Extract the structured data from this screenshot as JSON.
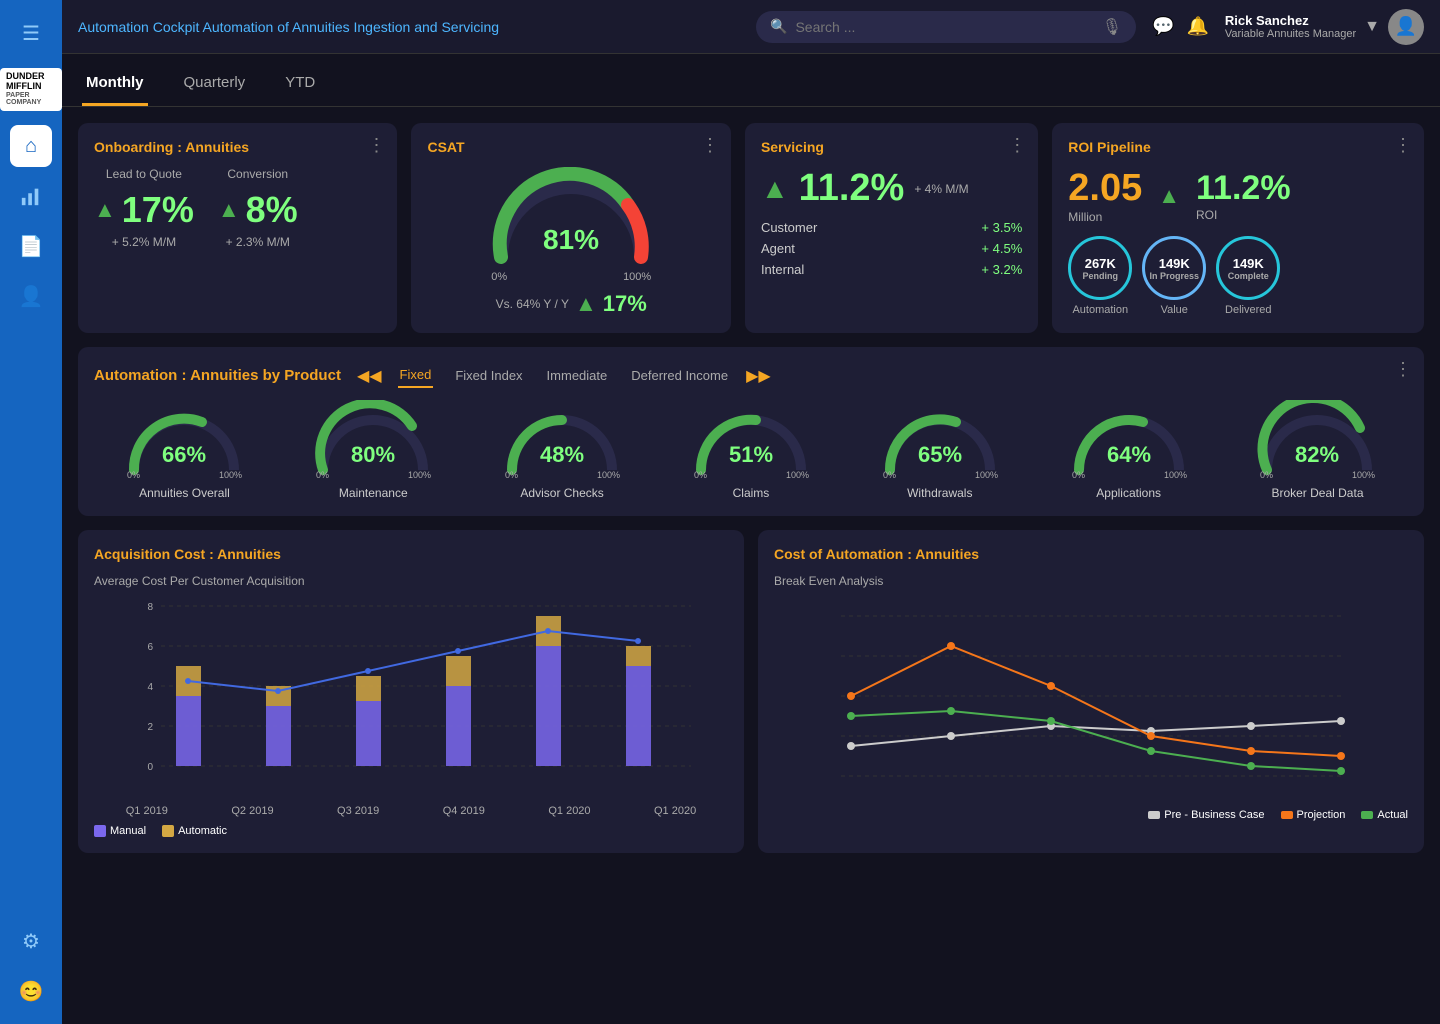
{
  "topbar": {
    "title": "Automation Cockpit Automation of Annuities Ingestion and Servicing",
    "search_placeholder": "Search ...",
    "user_name": "Rick Sanchez",
    "user_role": "Variable Annuites Manager"
  },
  "tabs": [
    {
      "label": "Monthly",
      "active": true
    },
    {
      "label": "Quarterly",
      "active": false
    },
    {
      "label": "YTD",
      "active": false
    }
  ],
  "onboarding": {
    "title": "Onboarding : Annuities",
    "lead_label": "Lead to Quote",
    "conversion_label": "Conversion",
    "lead_value": "17%",
    "conversion_value": "8%",
    "lead_sub": "+ 5.2% M/M",
    "conversion_sub": "+ 2.3% M/M"
  },
  "csat": {
    "title": "CSAT",
    "value": 81,
    "vs_label": "Vs.  64% Y / Y",
    "vs_value": "17%"
  },
  "servicing": {
    "title": "Servicing",
    "main_value": "11.2%",
    "main_delta": "+ 4% M/M",
    "rows": [
      {
        "label": "Customer",
        "value": "+ 3.5%"
      },
      {
        "label": "Agent",
        "value": "+ 4.5%"
      },
      {
        "label": "Internal",
        "value": "+ 3.2%"
      }
    ]
  },
  "roi": {
    "title": "ROI Pipeline",
    "million_value": "2.05",
    "million_label": "Million",
    "roi_pct": "11.2%",
    "roi_label": "ROI",
    "circles": [
      {
        "value": "267K",
        "sub": "Pending",
        "bottom": "Automation"
      },
      {
        "value": "149K",
        "sub": "In Progress",
        "bottom": "Value"
      },
      {
        "value": "149K",
        "sub": "Complete",
        "bottom": "Delivered"
      }
    ]
  },
  "automation": {
    "title": "Automation : Annuities by Product",
    "product_tabs": [
      "Fixed",
      "Fixed Index",
      "Immediate",
      "Deferred Income"
    ],
    "active_tab": "Fixed",
    "gauges": [
      {
        "label": "Annuities Overall",
        "pct": 66
      },
      {
        "label": "Maintenance",
        "pct": 80
      },
      {
        "label": "Advisor Checks",
        "pct": 48
      },
      {
        "label": "Claims",
        "pct": 51
      },
      {
        "label": "Withdrawals",
        "pct": 65
      },
      {
        "label": "Applications",
        "pct": 64
      },
      {
        "label": "Broker Deal Data",
        "pct": 82
      }
    ]
  },
  "acquisition": {
    "title": "Acquisition Cost : Annuities",
    "subtitle": "Average Cost Per Customer Acquisition",
    "x_labels": [
      "Q1 2019",
      "Q2 2019",
      "Q3 2019",
      "Q4 2019",
      "Q1 2020",
      "Q1 2020"
    ],
    "legend": [
      {
        "label": "Manual",
        "color": "#7b68ee"
      },
      {
        "label": "Automatic",
        "color": "#d4a843"
      }
    ]
  },
  "cost": {
    "title": "Cost of Automation : Annuities",
    "subtitle": "Break Even Analysis",
    "legend": [
      {
        "label": "Pre - Business Case",
        "color": "#ccc"
      },
      {
        "label": "Projection",
        "color": "#f5761a"
      },
      {
        "label": "Actual",
        "color": "#4caf50"
      }
    ]
  },
  "sidebar": {
    "items": [
      {
        "icon": "☰",
        "name": "menu"
      },
      {
        "icon": "⌂",
        "name": "home",
        "active": true
      },
      {
        "icon": "▦",
        "name": "grid"
      },
      {
        "icon": "📄",
        "name": "document"
      },
      {
        "icon": "👤",
        "name": "user"
      }
    ],
    "bottom": [
      {
        "icon": "⚙",
        "name": "settings"
      },
      {
        "icon": "😊",
        "name": "profile"
      }
    ]
  }
}
